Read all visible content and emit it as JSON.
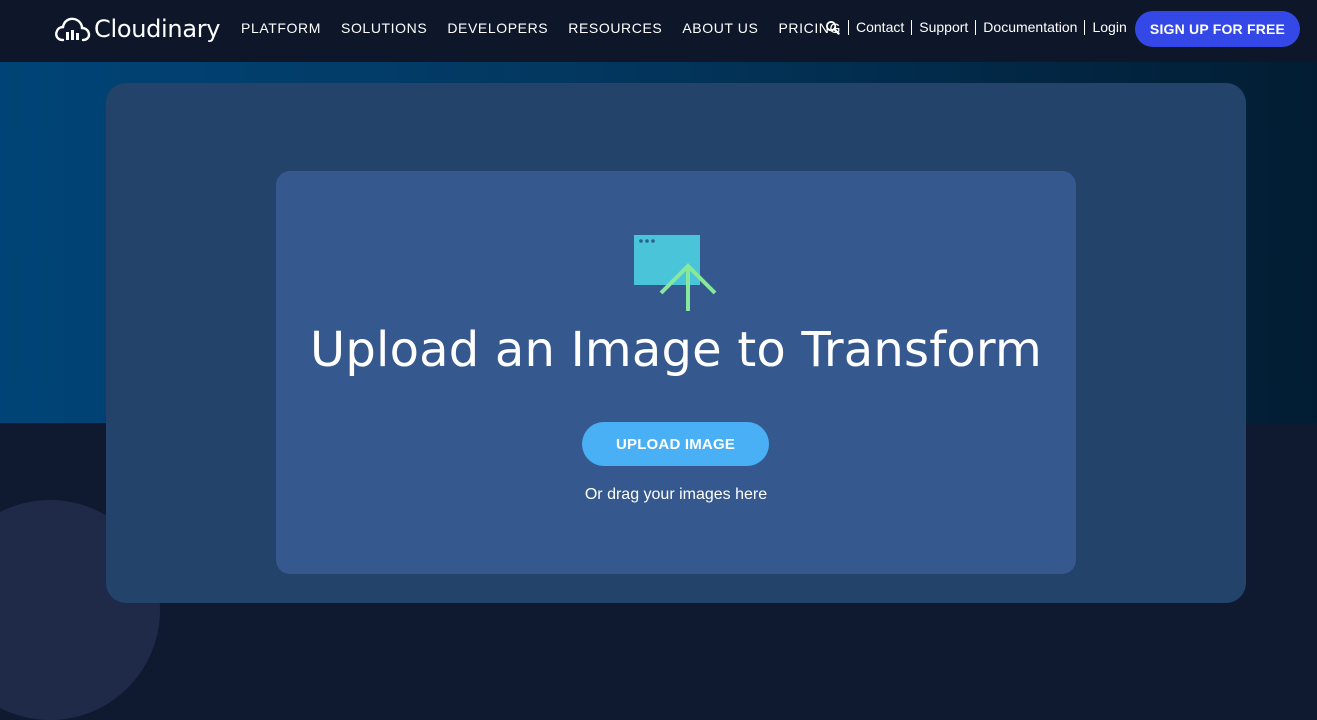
{
  "brand": {
    "name": "Cloudinary",
    "icon": "cloud-logo-icon"
  },
  "nav": {
    "items": [
      {
        "label": "PLATFORM"
      },
      {
        "label": "SOLUTIONS"
      },
      {
        "label": "DEVELOPERS"
      },
      {
        "label": "RESOURCES"
      },
      {
        "label": "ABOUT US"
      },
      {
        "label": "PRICING"
      }
    ]
  },
  "utility": {
    "search_icon": "search-icon",
    "links": [
      {
        "label": "Contact"
      },
      {
        "label": "Support"
      },
      {
        "label": "Documentation"
      },
      {
        "label": "Login"
      }
    ]
  },
  "signup": {
    "label": "SIGN UP FOR FREE"
  },
  "upload": {
    "icon": "upload-window-icon",
    "title": "Upload an Image to Transform",
    "button_label": "UPLOAD IMAGE",
    "drag_hint": "Or drag your images here"
  },
  "colors": {
    "accent": "#3448e8",
    "upload_button": "#4ab0f6",
    "icon_window": "#4ac4d9",
    "icon_arrow": "#88e89c"
  }
}
